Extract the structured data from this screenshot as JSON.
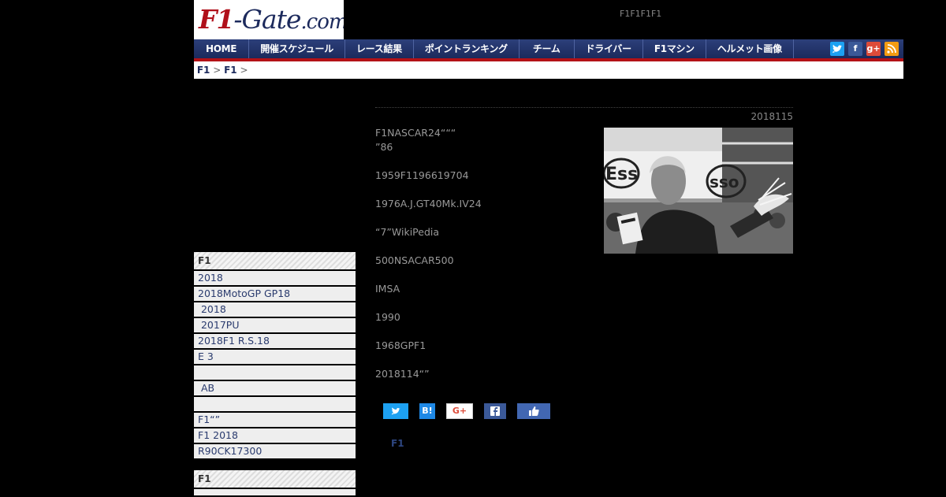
{
  "header": {
    "logo_f1": "F1",
    "logo_rest": "-Gate",
    "logo_domain": ".com",
    "tagline": "F1F1F1F1"
  },
  "nav": {
    "items": [
      "HOME",
      "開催スケジュール",
      "レース結果",
      "ポイントランキング",
      "チーム",
      "ドライバー",
      "F1マシン",
      "ヘルメット画像"
    ],
    "social_icons": [
      "twitter-icon",
      "facebook-icon",
      "google-plus-icon",
      "rss-icon"
    ]
  },
  "breadcrumb": {
    "items": [
      "F1",
      "F1"
    ],
    "separator": ">"
  },
  "sidebar": {
    "sections": [
      {
        "heading": "F1",
        "items": [
          "2018",
          "2018MotoGP GP18",
          " 2018",
          " 2017PU",
          "2018F1 R.S.18",
          "E 3",
          "",
          " AB",
          "",
          "F1“”",
          "F1 2018",
          "R90CK17300"
        ]
      },
      {
        "heading": "F1",
        "items": []
      }
    ]
  },
  "article": {
    "date": "2018115",
    "paragraphs": [
      "F1NASCAR24“““\n”86",
      "1959F1196619704",
      "1976A.J.GT40Mk.IV24",
      "“7”WikiPedia",
      "500NSACAR500",
      "IMSA",
      "1990",
      "1968GPF1",
      "2018114“”"
    ],
    "share_buttons": [
      {
        "name": "tweet-button",
        "label": "",
        "color": "#1da1f2"
      },
      {
        "name": "hatena-button",
        "label": "B!",
        "color": "#1e88e5"
      },
      {
        "name": "google-plus-button",
        "label": "G+",
        "color": "#ffffff"
      },
      {
        "name": "facebook-share-button",
        "label": "f",
        "color": "#3b5998"
      },
      {
        "name": "like-button",
        "label": "",
        "color": "#4267b2"
      }
    ],
    "tag": "F1"
  },
  "colors": {
    "nav_bg": "#1b2a5c",
    "accent_red": "#b31217",
    "link": "#2a3b6e"
  }
}
